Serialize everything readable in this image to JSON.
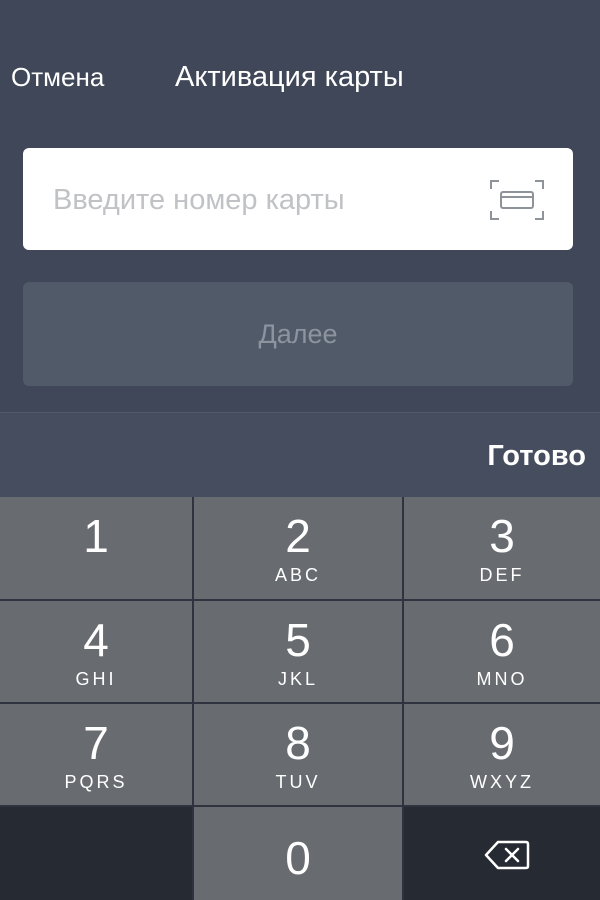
{
  "header": {
    "cancel_label": "Отмена",
    "title": "Активация карты"
  },
  "card_field": {
    "placeholder": "Введите номер карты",
    "value": "",
    "scan_icon": "card-scan-icon"
  },
  "next_button": {
    "label": "Далее",
    "enabled": false
  },
  "keyboard": {
    "done_label": "Готово",
    "keys": [
      {
        "digit": "1",
        "letters": ""
      },
      {
        "digit": "2",
        "letters": "ABC"
      },
      {
        "digit": "3",
        "letters": "DEF"
      },
      {
        "digit": "4",
        "letters": "GHI"
      },
      {
        "digit": "5",
        "letters": "JKL"
      },
      {
        "digit": "6",
        "letters": "MNO"
      },
      {
        "digit": "7",
        "letters": "PQRS"
      },
      {
        "digit": "8",
        "letters": "TUV"
      },
      {
        "digit": "9",
        "letters": "WXYZ"
      },
      {
        "digit": "0",
        "letters": ""
      }
    ],
    "delete_icon": "backspace-icon"
  },
  "colors": {
    "background": "#3f4758",
    "field_background": "#ffffff",
    "button_disabled": "#515a69",
    "key_background": "#686b70"
  }
}
